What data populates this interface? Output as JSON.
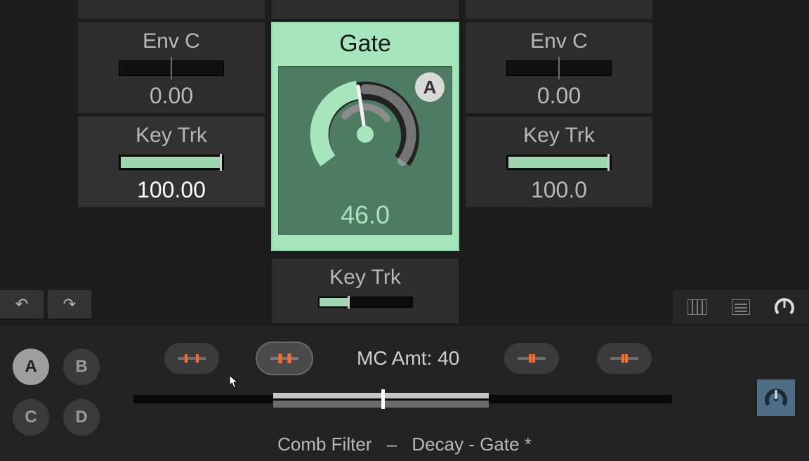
{
  "left": {
    "env_label": "Env C",
    "env_value": "0.00",
    "key_label": "Key Trk",
    "key_value": "100.00"
  },
  "right": {
    "env_label": "Env C",
    "env_value": "0.00",
    "key_label": "Key Trk",
    "key_value": "100.0"
  },
  "center": {
    "title": "Gate",
    "badge": "A",
    "value": "46.0",
    "dial_percent": 46,
    "keytrk_label": "Key Trk",
    "keytrk_percent": 31
  },
  "bottom": {
    "macro_letters": [
      "A",
      "B",
      "C",
      "D"
    ],
    "macro_active_index": 0,
    "mc_label": "MC Amt:",
    "mc_value": "40",
    "breadcrumb": [
      "Comb Filter",
      "Decay - Gate *"
    ],
    "slider": {
      "value": 46,
      "range_low": 26,
      "range_high": 66
    },
    "pill_active_index": 1
  },
  "icons": {
    "undo": "↶",
    "redo": "↷"
  }
}
